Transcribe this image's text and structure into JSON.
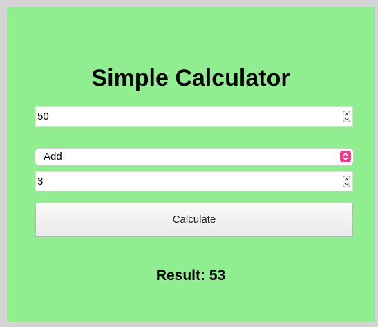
{
  "title": "Simple Calculator",
  "first_number": {
    "value": "50"
  },
  "operation": {
    "selected": "Add"
  },
  "second_number": {
    "value": "3"
  },
  "calculate_button": {
    "label": "Calculate"
  },
  "result": {
    "text": "Result: 53"
  },
  "colors": {
    "panel_background": "#90ee90",
    "page_background": "#d4d4d4",
    "select_accent": "#e83d87"
  },
  "icons": {
    "stepper": "up-down-stepper-icon",
    "select": "chevron-up-down-icon"
  }
}
